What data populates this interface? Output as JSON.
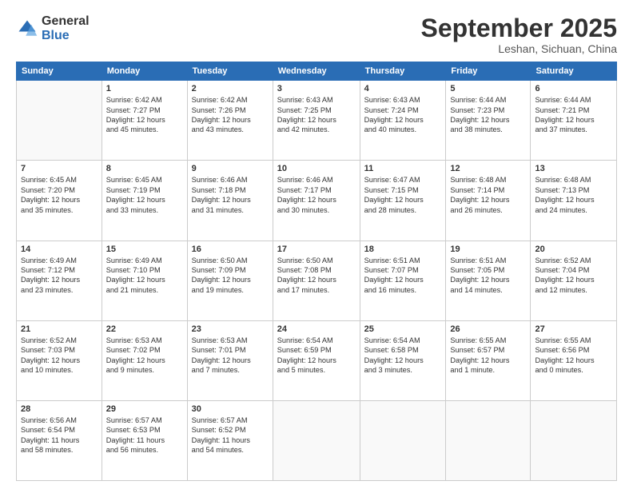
{
  "logo": {
    "general": "General",
    "blue": "Blue"
  },
  "title": {
    "month_year": "September 2025",
    "location": "Leshan, Sichuan, China"
  },
  "weekdays": [
    "Sunday",
    "Monday",
    "Tuesday",
    "Wednesday",
    "Thursday",
    "Friday",
    "Saturday"
  ],
  "weeks": [
    [
      {
        "day": "",
        "detail": ""
      },
      {
        "day": "1",
        "detail": "Sunrise: 6:42 AM\nSunset: 7:27 PM\nDaylight: 12 hours\nand 45 minutes."
      },
      {
        "day": "2",
        "detail": "Sunrise: 6:42 AM\nSunset: 7:26 PM\nDaylight: 12 hours\nand 43 minutes."
      },
      {
        "day": "3",
        "detail": "Sunrise: 6:43 AM\nSunset: 7:25 PM\nDaylight: 12 hours\nand 42 minutes."
      },
      {
        "day": "4",
        "detail": "Sunrise: 6:43 AM\nSunset: 7:24 PM\nDaylight: 12 hours\nand 40 minutes."
      },
      {
        "day": "5",
        "detail": "Sunrise: 6:44 AM\nSunset: 7:23 PM\nDaylight: 12 hours\nand 38 minutes."
      },
      {
        "day": "6",
        "detail": "Sunrise: 6:44 AM\nSunset: 7:21 PM\nDaylight: 12 hours\nand 37 minutes."
      }
    ],
    [
      {
        "day": "7",
        "detail": "Sunrise: 6:45 AM\nSunset: 7:20 PM\nDaylight: 12 hours\nand 35 minutes."
      },
      {
        "day": "8",
        "detail": "Sunrise: 6:45 AM\nSunset: 7:19 PM\nDaylight: 12 hours\nand 33 minutes."
      },
      {
        "day": "9",
        "detail": "Sunrise: 6:46 AM\nSunset: 7:18 PM\nDaylight: 12 hours\nand 31 minutes."
      },
      {
        "day": "10",
        "detail": "Sunrise: 6:46 AM\nSunset: 7:17 PM\nDaylight: 12 hours\nand 30 minutes."
      },
      {
        "day": "11",
        "detail": "Sunrise: 6:47 AM\nSunset: 7:15 PM\nDaylight: 12 hours\nand 28 minutes."
      },
      {
        "day": "12",
        "detail": "Sunrise: 6:48 AM\nSunset: 7:14 PM\nDaylight: 12 hours\nand 26 minutes."
      },
      {
        "day": "13",
        "detail": "Sunrise: 6:48 AM\nSunset: 7:13 PM\nDaylight: 12 hours\nand 24 minutes."
      }
    ],
    [
      {
        "day": "14",
        "detail": "Sunrise: 6:49 AM\nSunset: 7:12 PM\nDaylight: 12 hours\nand 23 minutes."
      },
      {
        "day": "15",
        "detail": "Sunrise: 6:49 AM\nSunset: 7:10 PM\nDaylight: 12 hours\nand 21 minutes."
      },
      {
        "day": "16",
        "detail": "Sunrise: 6:50 AM\nSunset: 7:09 PM\nDaylight: 12 hours\nand 19 minutes."
      },
      {
        "day": "17",
        "detail": "Sunrise: 6:50 AM\nSunset: 7:08 PM\nDaylight: 12 hours\nand 17 minutes."
      },
      {
        "day": "18",
        "detail": "Sunrise: 6:51 AM\nSunset: 7:07 PM\nDaylight: 12 hours\nand 16 minutes."
      },
      {
        "day": "19",
        "detail": "Sunrise: 6:51 AM\nSunset: 7:05 PM\nDaylight: 12 hours\nand 14 minutes."
      },
      {
        "day": "20",
        "detail": "Sunrise: 6:52 AM\nSunset: 7:04 PM\nDaylight: 12 hours\nand 12 minutes."
      }
    ],
    [
      {
        "day": "21",
        "detail": "Sunrise: 6:52 AM\nSunset: 7:03 PM\nDaylight: 12 hours\nand 10 minutes."
      },
      {
        "day": "22",
        "detail": "Sunrise: 6:53 AM\nSunset: 7:02 PM\nDaylight: 12 hours\nand 9 minutes."
      },
      {
        "day": "23",
        "detail": "Sunrise: 6:53 AM\nSunset: 7:01 PM\nDaylight: 12 hours\nand 7 minutes."
      },
      {
        "day": "24",
        "detail": "Sunrise: 6:54 AM\nSunset: 6:59 PM\nDaylight: 12 hours\nand 5 minutes."
      },
      {
        "day": "25",
        "detail": "Sunrise: 6:54 AM\nSunset: 6:58 PM\nDaylight: 12 hours\nand 3 minutes."
      },
      {
        "day": "26",
        "detail": "Sunrise: 6:55 AM\nSunset: 6:57 PM\nDaylight: 12 hours\nand 1 minute."
      },
      {
        "day": "27",
        "detail": "Sunrise: 6:55 AM\nSunset: 6:56 PM\nDaylight: 12 hours\nand 0 minutes."
      }
    ],
    [
      {
        "day": "28",
        "detail": "Sunrise: 6:56 AM\nSunset: 6:54 PM\nDaylight: 11 hours\nand 58 minutes."
      },
      {
        "day": "29",
        "detail": "Sunrise: 6:57 AM\nSunset: 6:53 PM\nDaylight: 11 hours\nand 56 minutes."
      },
      {
        "day": "30",
        "detail": "Sunrise: 6:57 AM\nSunset: 6:52 PM\nDaylight: 11 hours\nand 54 minutes."
      },
      {
        "day": "",
        "detail": ""
      },
      {
        "day": "",
        "detail": ""
      },
      {
        "day": "",
        "detail": ""
      },
      {
        "day": "",
        "detail": ""
      }
    ]
  ]
}
